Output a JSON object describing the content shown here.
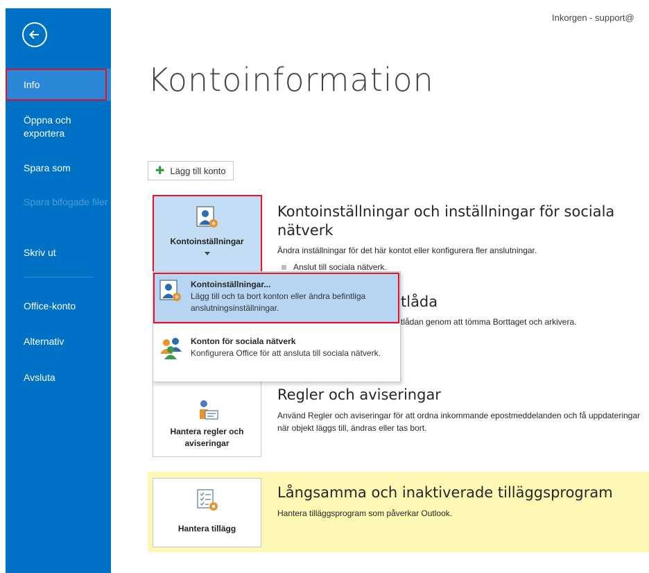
{
  "window": {
    "title": "Inkorgen - support@"
  },
  "sidebar": {
    "back_icon": "back-arrow-icon",
    "items": [
      {
        "label": "Info",
        "active": true
      },
      {
        "label": "Öppna och exportera"
      },
      {
        "label": "Spara som"
      },
      {
        "label": "Spara bifogade filer",
        "disabled": true
      },
      {
        "label": "Skriv ut"
      },
      {
        "label": "Office-konto"
      },
      {
        "label": "Alternativ"
      },
      {
        "label": "Avsluta"
      }
    ]
  },
  "main": {
    "page_title": "Kontoinformation",
    "add_account_label": "Lägg till konto",
    "account_settings": {
      "tile_label": "Kontoinställningar",
      "title": "Kontoinställningar och inställningar för sociala nätverk",
      "description": "Ändra inställningar för det här kontot eller konfigurera fler anslutningar.",
      "bullet": "Anslut till sociala nätverk."
    },
    "mailbox": {
      "title_partial": "tlåda",
      "description_partial": "tlådan genom att tömma Borttaget och arkivera."
    },
    "rules": {
      "tile_label": "Hantera regler och aviseringar",
      "title": "Regler och aviseringar",
      "description": "Använd Regler och aviseringar för att ordna inkommande epostmeddelanden och få uppdateringar när objekt läggs till, ändras eller tas bort."
    },
    "addins": {
      "tile_label": "Hantera tillägg",
      "title": "Långsamma och inaktiverade tilläggsprogram",
      "description": "Hantera tilläggsprogram som påverkar Outlook."
    }
  },
  "dropdown": {
    "items": [
      {
        "title": "Kontoinställningar...",
        "description": "Lägg till och ta bort konton eller ändra befintliga anslutningsinställningar."
      },
      {
        "title": "Konton för sociala nätverk",
        "description": "Konfigurera Office för att ansluta till sociala nätverk."
      }
    ]
  },
  "colors": {
    "sidebar": "#0072c6",
    "highlight": "#e81123",
    "addins_bg": "#fdf8b3",
    "selected_tile": "#c3ddf4"
  }
}
